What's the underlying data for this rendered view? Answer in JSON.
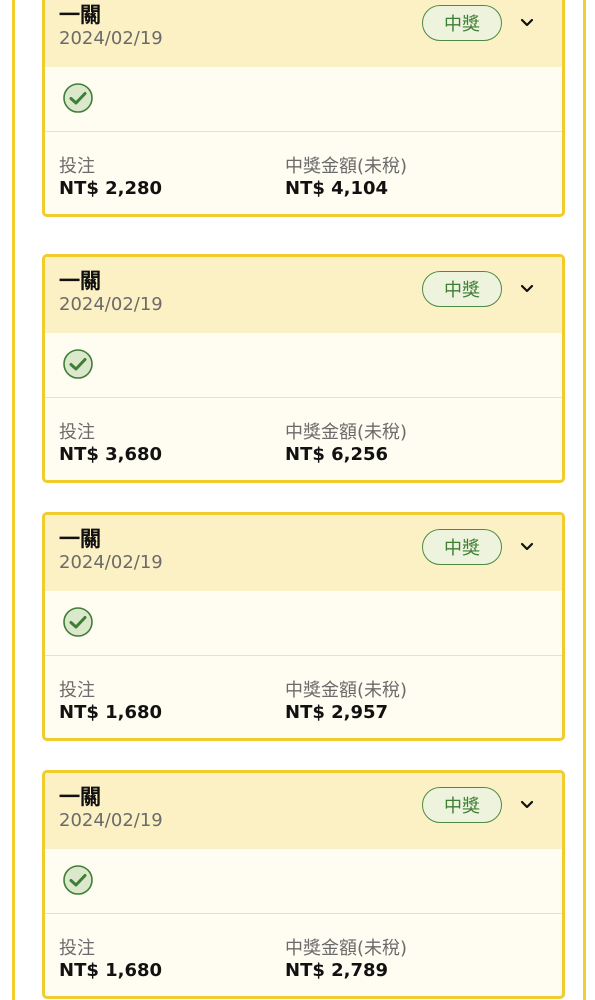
{
  "cards": [
    {
      "title": "一關",
      "date": "2024/02/19",
      "badge": "中獎",
      "bet_label": "投注",
      "bet_value": "NT$ 2,280",
      "prize_label": "中獎金額(未稅)",
      "prize_value": "NT$ 4,104"
    },
    {
      "title": "一關",
      "date": "2024/02/19",
      "badge": "中獎",
      "bet_label": "投注",
      "bet_value": "NT$ 3,680",
      "prize_label": "中獎金額(未稅)",
      "prize_value": "NT$ 6,256"
    },
    {
      "title": "一關",
      "date": "2024/02/19",
      "badge": "中獎",
      "bet_label": "投注",
      "bet_value": "NT$ 1,680",
      "prize_label": "中獎金額(未稅)",
      "prize_value": "NT$ 2,957"
    },
    {
      "title": "一關",
      "date": "2024/02/19",
      "badge": "中獎",
      "bet_label": "投注",
      "bet_value": "NT$ 1,680",
      "prize_label": "中獎金額(未稅)",
      "prize_value": "NT$ 2,789"
    }
  ],
  "icons": {
    "status": "check-circle-icon",
    "expand": "chevron-down-icon"
  },
  "colors": {
    "border": "#f1cc2c",
    "header_bg": "#fcf1c4",
    "body_bg": "#fffcf1",
    "badge_green": "#3f7e35"
  }
}
